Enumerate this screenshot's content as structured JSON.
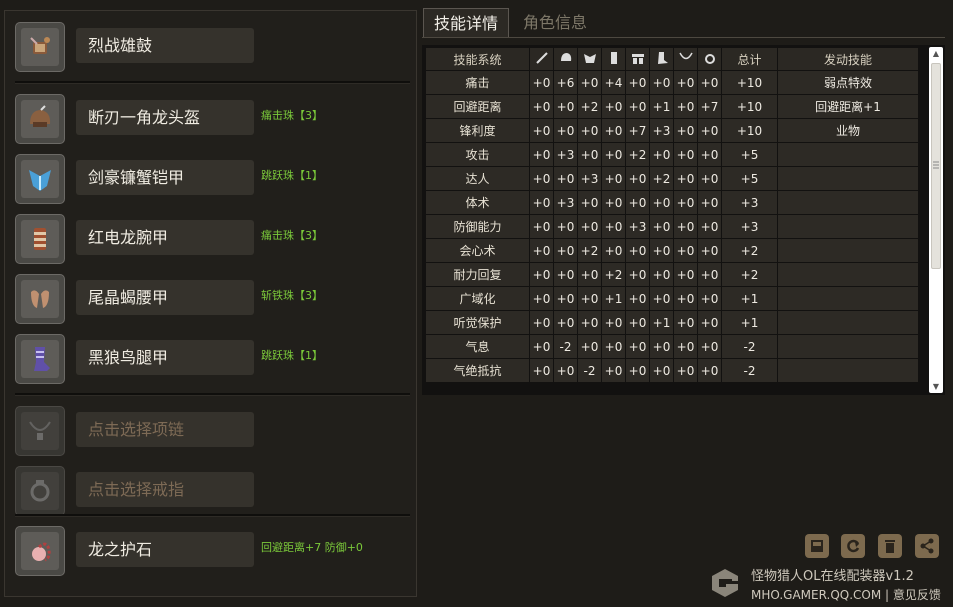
{
  "equipment": [
    {
      "name": "烈战雄鼓",
      "gem": "",
      "icon": "drum-weapon-icon",
      "placeholder": false
    },
    {
      "name": "断刃一角龙头盔",
      "gem": "痛击珠【3】",
      "icon": "helmet-icon",
      "placeholder": false
    },
    {
      "name": "剑豪镰蟹铠甲",
      "gem": "跳跃珠【1】",
      "icon": "chest-armor-icon",
      "placeholder": false
    },
    {
      "name": "红电龙腕甲",
      "gem": "痛击珠【3】",
      "icon": "arm-armor-icon",
      "placeholder": false
    },
    {
      "name": "尾晶蝎腰甲",
      "gem": "斩铁珠【3】",
      "icon": "waist-armor-icon",
      "placeholder": false
    },
    {
      "name": "黑狼鸟腿甲",
      "gem": "跳跃珠【1】",
      "icon": "leg-armor-icon",
      "placeholder": false
    },
    {
      "name": "点击选择项链",
      "gem": "",
      "icon": "necklace-icon",
      "placeholder": true
    },
    {
      "name": "点击选择戒指",
      "gem": "",
      "icon": "ring-icon",
      "placeholder": true
    },
    {
      "name": "龙之护石",
      "gem": "回避距离+7  防御+0",
      "icon": "talisman-icon",
      "placeholder": false
    }
  ],
  "tabs": {
    "skill_detail": "技能详情",
    "character_info": "角色信息"
  },
  "table": {
    "header_first": "技能系统",
    "header_total": "总计",
    "header_active": "发动技能",
    "column_icons": [
      "weapon-col-icon",
      "helmet-col-icon",
      "chest-col-icon",
      "arm-col-icon",
      "waist-col-icon",
      "leg-col-icon",
      "necklace-col-icon",
      "ring-col-icon"
    ],
    "rows": [
      {
        "name": "痛击",
        "vals": [
          "+0",
          "+6",
          "+0",
          "+4",
          "+0",
          "+0",
          "+0",
          "+0"
        ],
        "total": "+10",
        "active": "弱点特效"
      },
      {
        "name": "回避距离",
        "vals": [
          "+0",
          "+0",
          "+2",
          "+0",
          "+0",
          "+1",
          "+0",
          "+7"
        ],
        "total": "+10",
        "active": "回避距离+1"
      },
      {
        "name": "锋利度",
        "vals": [
          "+0",
          "+0",
          "+0",
          "+0",
          "+7",
          "+3",
          "+0",
          "+0"
        ],
        "total": "+10",
        "active": "业物"
      },
      {
        "name": "攻击",
        "vals": [
          "+0",
          "+3",
          "+0",
          "+0",
          "+2",
          "+0",
          "+0",
          "+0"
        ],
        "total": "+5",
        "active": ""
      },
      {
        "name": "达人",
        "vals": [
          "+0",
          "+0",
          "+3",
          "+0",
          "+0",
          "+2",
          "+0",
          "+0"
        ],
        "total": "+5",
        "active": ""
      },
      {
        "name": "体术",
        "vals": [
          "+0",
          "+3",
          "+0",
          "+0",
          "+0",
          "+0",
          "+0",
          "+0"
        ],
        "total": "+3",
        "active": ""
      },
      {
        "name": "防御能力",
        "vals": [
          "+0",
          "+0",
          "+0",
          "+0",
          "+3",
          "+0",
          "+0",
          "+0"
        ],
        "total": "+3",
        "active": ""
      },
      {
        "name": "会心术",
        "vals": [
          "+0",
          "+0",
          "+2",
          "+0",
          "+0",
          "+0",
          "+0",
          "+0"
        ],
        "total": "+2",
        "active": ""
      },
      {
        "name": "耐力回复",
        "vals": [
          "+0",
          "+0",
          "+0",
          "+2",
          "+0",
          "+0",
          "+0",
          "+0"
        ],
        "total": "+2",
        "active": ""
      },
      {
        "name": "广域化",
        "vals": [
          "+0",
          "+0",
          "+0",
          "+1",
          "+0",
          "+0",
          "+0",
          "+0"
        ],
        "total": "+1",
        "active": ""
      },
      {
        "name": "听觉保护",
        "vals": [
          "+0",
          "+0",
          "+0",
          "+0",
          "+0",
          "+1",
          "+0",
          "+0"
        ],
        "total": "+1",
        "active": ""
      },
      {
        "name": "气息",
        "vals": [
          "+0",
          "-2",
          "+0",
          "+0",
          "+0",
          "+0",
          "+0",
          "+0"
        ],
        "total": "-2",
        "active": ""
      },
      {
        "name": "气绝抵抗",
        "vals": [
          "+0",
          "+0",
          "-2",
          "+0",
          "+0",
          "+0",
          "+0",
          "+0"
        ],
        "total": "-2",
        "active": ""
      }
    ]
  },
  "toolbar": [
    "save-icon",
    "refresh-icon",
    "delete-icon",
    "share-icon"
  ],
  "brand": {
    "title": "怪物猎人OL在线配装器v1.2",
    "sub": "MHO.GAMER.QQ.COM | 意见反馈"
  },
  "colors": {
    "gem_text": "#7bc93a",
    "button_bg": "#7d6a4e",
    "placeholder_text": "#7d6a55"
  }
}
